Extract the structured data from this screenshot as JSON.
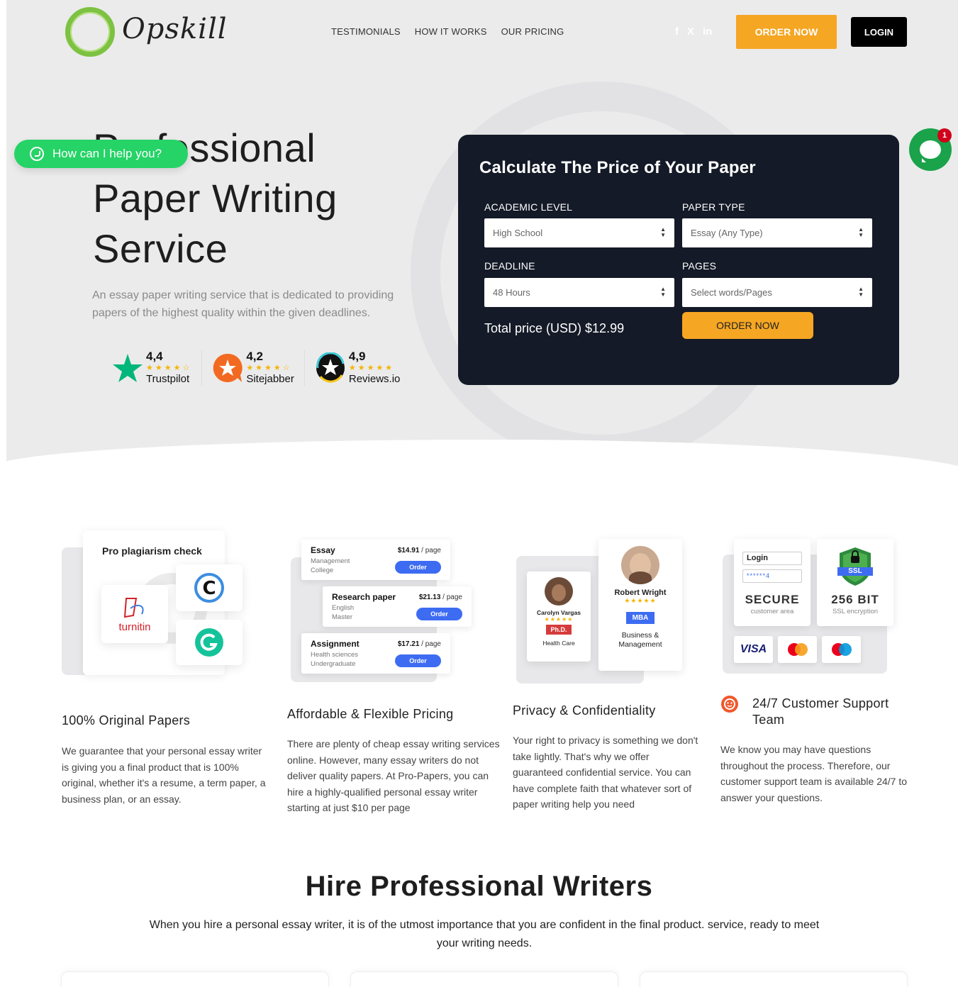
{
  "brand": {
    "name": "Opskill"
  },
  "nav": {
    "items": [
      "TESTIMONIALS",
      "HOW IT WORKS",
      "OUR PRICING"
    ]
  },
  "social": {
    "facebook": "f",
    "twitter": "X",
    "linkedin": "in"
  },
  "header": {
    "order_label": "ORDER NOW",
    "login_label": "LOGIN"
  },
  "hero": {
    "title_line1": "Professional",
    "title_line2": "Paper Writing",
    "title_line3": "Service",
    "subtitle": "An essay paper writing service that is dedicated to providing papers of the highest quality within the given deadlines."
  },
  "ratings": [
    {
      "score": "4,4",
      "name": "Trustpilot",
      "stars": "★★★★☆"
    },
    {
      "score": "4,2",
      "name": "Sitejabber",
      "stars": "★★★★☆"
    },
    {
      "score": "4,9",
      "name": "Reviews.io",
      "stars": "★★★★★"
    }
  ],
  "whatsapp": {
    "label": "How can I help you?"
  },
  "chat": {
    "badge": "1"
  },
  "calculator": {
    "title": "Calculate The Price of Your Paper",
    "academic_label": "ACADEMIC LEVEL",
    "academic_value": "High School",
    "paper_type_label": "PAPER TYPE",
    "paper_type_value": "Essay (Any Type)",
    "deadline_label": "DEADLINE",
    "deadline_value": "48 Hours",
    "pages_label": "PAGES",
    "pages_value": "Select words/Pages",
    "total": "Total price (USD) $12.99",
    "order_label": "ORDER NOW"
  },
  "features": {
    "plagiarism": {
      "card_title": "Pro plagiarism check",
      "turnitin": "turnitin",
      "title": "100% Original Papers",
      "text": "We guarantee that your personal essay writer is giving you a final product that is 100% original, whether it's a resume, a term paper, a business plan, or an essay."
    },
    "pricing": {
      "rows": [
        {
          "name": "Essay",
          "sub1": "Management",
          "sub2": "College",
          "price": "$14.91",
          "unit": " / page",
          "btn": "Order"
        },
        {
          "name": "Research paper",
          "sub1": "English",
          "sub2": "Master",
          "price": "$21.13",
          "unit": " / page",
          "btn": "Order"
        },
        {
          "name": "Assignment",
          "sub1": "Health sciences",
          "sub2": "Undergraduate",
          "price": "$17.21",
          "unit": " / page",
          "btn": "Order"
        }
      ],
      "title": "Affordable & Flexible Pricing",
      "text": "There are plenty of cheap essay writing services online. However, many essay writers do not deliver quality papers. At Pro-Papers, you can hire a highly-qualified personal essay writer starting at just $10 per page"
    },
    "privacy": {
      "writer1": {
        "name": "Carolyn Vargas",
        "stars": "★★★★★",
        "degree": "Ph.D.",
        "field": "Health Care"
      },
      "writer2": {
        "name": "Robert Wright",
        "stars": "★★★★★",
        "degree": "MBA",
        "field_line1": "Business &",
        "field_line2": "Management"
      },
      "title": "Privacy & Confidentiality",
      "text": "Your right to privacy is something we don't take lightly. That's why we offer guaranteed confidential service. You can have complete faith that whatever sort of paper writing help you need"
    },
    "support": {
      "login_label": "Login",
      "password_mask": "******4",
      "secure_title": "SECURE",
      "secure_sub": "customer area",
      "ssl_badge": "SSL",
      "bit_title": "256 BIT",
      "bit_sub": "SSL encryption",
      "visa": "VISA",
      "title_line1": "24/7 Customer Support",
      "title_line2": "Team",
      "text": "We know you may have questions throughout the process. Therefore, our customer support team is available 24/7 to answer your questions."
    }
  },
  "hire": {
    "title": "Hire Professional Writers",
    "text": "When you hire a personal essay writer, it is of the utmost importance that you are confident in the final product.  service, ready to meet your writing needs."
  },
  "colors": {
    "accent": "#f5a623",
    "green": "#7dc242",
    "dark": "#141a27",
    "blue": "#3d6cf2",
    "whatsapp": "#25d366"
  }
}
